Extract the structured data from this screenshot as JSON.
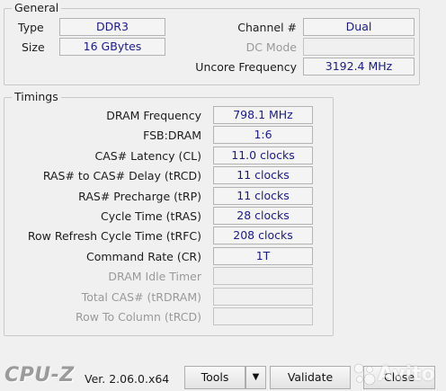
{
  "general": {
    "title": "General",
    "type_label": "Type",
    "type_value": "DDR3",
    "size_label": "Size",
    "size_value": "16 GBytes",
    "channel_label": "Channel #",
    "channel_value": "Dual",
    "dcmode_label": "DC Mode",
    "dcmode_value": "",
    "uncore_label": "Uncore Frequency",
    "uncore_value": "3192.4 MHz"
  },
  "timings": {
    "title": "Timings",
    "rows": [
      {
        "label": "DRAM Frequency",
        "value": "798.1 MHz",
        "enabled": true
      },
      {
        "label": "FSB:DRAM",
        "value": "1:6",
        "enabled": true
      },
      {
        "label": "CAS# Latency (CL)",
        "value": "11.0 clocks",
        "enabled": true
      },
      {
        "label": "RAS# to CAS# Delay (tRCD)",
        "value": "11 clocks",
        "enabled": true
      },
      {
        "label": "RAS# Precharge (tRP)",
        "value": "11 clocks",
        "enabled": true
      },
      {
        "label": "Cycle Time (tRAS)",
        "value": "28 clocks",
        "enabled": true
      },
      {
        "label": "Row Refresh Cycle Time (tRFC)",
        "value": "208 clocks",
        "enabled": true
      },
      {
        "label": "Command Rate (CR)",
        "value": "1T",
        "enabled": true
      },
      {
        "label": "DRAM Idle Timer",
        "value": "",
        "enabled": false
      },
      {
        "label": "Total CAS# (tRDRAM)",
        "value": "",
        "enabled": false
      },
      {
        "label": "Row To Column (tRCD)",
        "value": "",
        "enabled": false
      }
    ]
  },
  "footer": {
    "brand": "CPU-Z",
    "version": "Ver. 2.06.0.x64",
    "tools_label": "Tools",
    "tools_arrow": "▼",
    "validate_label": "Validate",
    "close_label": "Close"
  },
  "watermark": {
    "text": "Avito",
    "icon": "dots-logo-icon"
  },
  "colors": {
    "value_text": "#1a1a8c",
    "window_bg": "#f0f0f0"
  }
}
